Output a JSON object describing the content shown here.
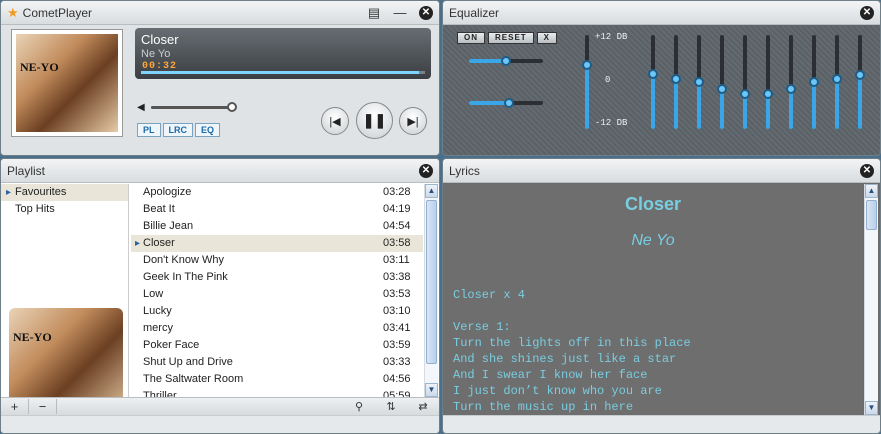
{
  "player": {
    "title": "CometPlayer",
    "song": "Closer",
    "artist": "Ne Yo",
    "time": "00:32",
    "cover_text": "NE-YO",
    "progress": 0.98,
    "volume": 0.95,
    "modes": [
      "PL",
      "LRC",
      "EQ"
    ]
  },
  "equalizer": {
    "title": "Equalizer",
    "buttons": {
      "on": "ON",
      "reset": "RESET",
      "x": "X"
    },
    "labels": {
      "max": "+12 DB",
      "mid": "0",
      "min": "-12 DB"
    },
    "balance": 0.5,
    "surround": 0.55,
    "preamp": 0.7,
    "bands": [
      0.6,
      0.53,
      0.5,
      0.42,
      0.36,
      0.36,
      0.42,
      0.5,
      0.53,
      0.58
    ]
  },
  "playlist": {
    "title": "Playlist",
    "categories": [
      "Favourites",
      "Top Hits"
    ],
    "selected_category": 0,
    "tracks": [
      {
        "title": "Apologize",
        "duration": "03:28"
      },
      {
        "title": "Beat It",
        "duration": "04:19"
      },
      {
        "title": "Billie Jean",
        "duration": "04:54"
      },
      {
        "title": "Closer",
        "duration": "03:58"
      },
      {
        "title": "Don't Know Why",
        "duration": "03:11"
      },
      {
        "title": "Geek In The Pink",
        "duration": "03:38"
      },
      {
        "title": "Low",
        "duration": "03:53"
      },
      {
        "title": "Lucky",
        "duration": "03:10"
      },
      {
        "title": "mercy",
        "duration": "03:41"
      },
      {
        "title": "Poker Face",
        "duration": "03:59"
      },
      {
        "title": "Shut Up and Drive",
        "duration": "03:33"
      },
      {
        "title": "The Saltwater Room",
        "duration": "04:56"
      },
      {
        "title": "Thriller",
        "duration": "05:59"
      }
    ],
    "selected_track": 3,
    "cover_text": "NE-YO",
    "bottom": {
      "add": "+",
      "remove": "−"
    }
  },
  "lyrics": {
    "title": "Lyrics",
    "song": "Closer",
    "artist": "Ne Yo",
    "lines": [
      "Closer x 4",
      "",
      "Verse 1:",
      "Turn the lights off in this place",
      "And she shines just like a star",
      "And I swear I know her face",
      "I just don’t know who you are",
      "Turn the music up in here"
    ]
  }
}
